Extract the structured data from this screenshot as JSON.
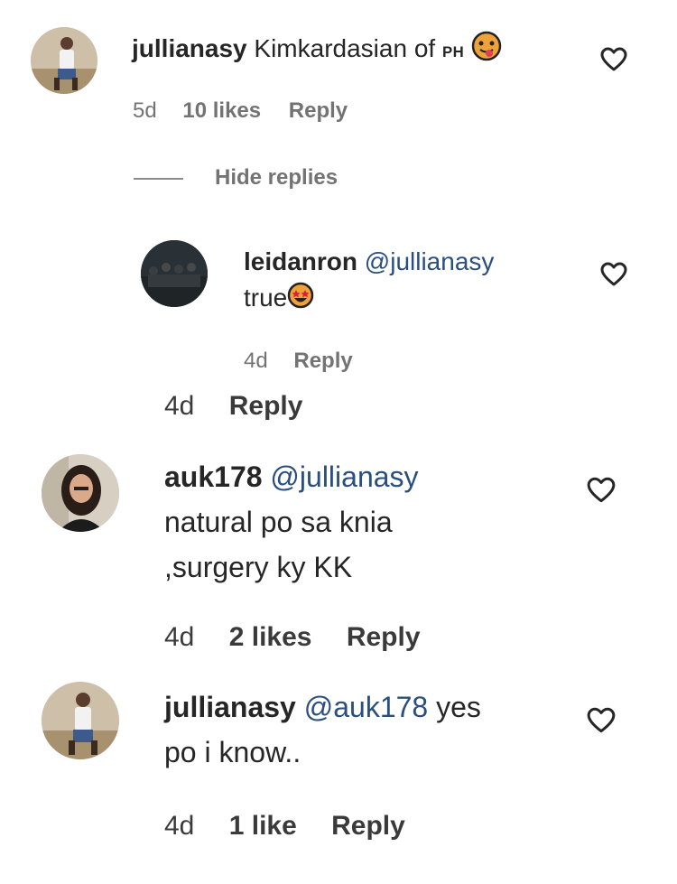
{
  "comments": [
    {
      "username": "jullianasy",
      "text": "Kimkardasian of",
      "text_suffix": "PH",
      "time": "5d",
      "likes": "10 likes",
      "reply": "Reply",
      "hide_replies": "Hide replies"
    },
    {
      "username": "leidanron",
      "mention": "@jullianasy",
      "text": "true",
      "time": "4d",
      "reply": "Reply"
    },
    {
      "time": "4d",
      "reply": "Reply"
    },
    {
      "username": "auk178",
      "mention": "@jullianasy",
      "line1": "natural po sa knia",
      "line2": ",surgery ky KK",
      "time": "4d",
      "likes": "2 likes",
      "reply": "Reply"
    },
    {
      "username": "jullianasy",
      "mention": "@auk178",
      "text": "yes",
      "line2": "po i know..",
      "time": "4d",
      "likes": "1 like",
      "reply": "Reply"
    }
  ],
  "icons": {
    "heart": "heart-icon",
    "emoji_tongue": "face-with-tongue-emoji",
    "emoji_star_eyes": "star-struck-emoji"
  },
  "colors": {
    "mention": "#2a4f7f",
    "meta": "#737373",
    "text": "#262626"
  }
}
